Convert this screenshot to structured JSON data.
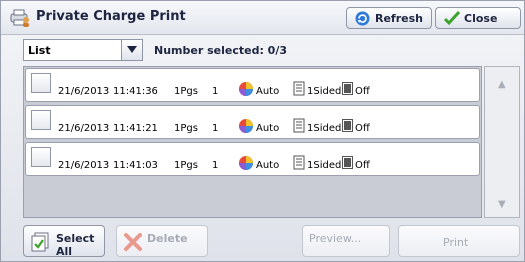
{
  "window": {
    "title": "Private Charge Print"
  },
  "header": {
    "refresh_label": "Refresh",
    "close_label": "Close"
  },
  "filter": {
    "view_value": "List",
    "number_selected": "Number selected: 0/3"
  },
  "jobs": [
    {
      "date": "21/6/2013",
      "time": "11:41:36",
      "pages": "1Pgs",
      "quantity": "1",
      "color": "Auto",
      "sides": "1Sided",
      "staple": "Off"
    },
    {
      "date": "21/6/2013",
      "time": "11:41:21",
      "pages": "1Pgs",
      "quantity": "1",
      "color": "Auto",
      "sides": "1Sided",
      "staple": "Off"
    },
    {
      "date": "21/6/2013",
      "time": "11:41:03",
      "pages": "1Pgs",
      "quantity": "1",
      "color": "Auto",
      "sides": "1Sided",
      "staple": "Off"
    }
  ],
  "scrollbar": {
    "up": "▲",
    "down": "▼"
  },
  "footer": {
    "select_all_label": "Select All",
    "delete_label": "Delete",
    "preview_label": "Preview...",
    "print_label": "Print"
  },
  "colors": {
    "title_text": "#1d2540",
    "disabled_text": "#a6abb5",
    "frame_bg": "#dfe2ea"
  }
}
